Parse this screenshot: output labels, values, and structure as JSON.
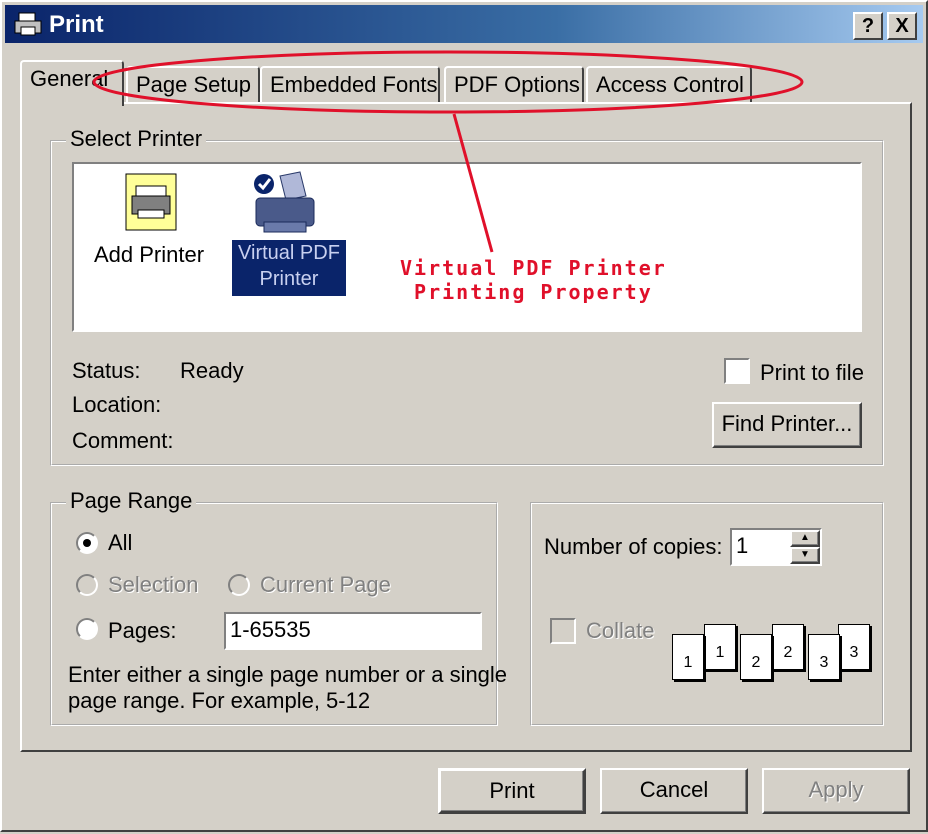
{
  "window": {
    "title": "Print",
    "help_button": "?",
    "close_button": "X"
  },
  "tabs": [
    {
      "label": "General"
    },
    {
      "label": "Page Setup"
    },
    {
      "label": "Embedded Fonts"
    },
    {
      "label": "PDF Options"
    },
    {
      "label": "Access Control"
    }
  ],
  "select_printer": {
    "legend": "Select Printer",
    "printers": [
      {
        "label": "Add Printer",
        "icon": "add-printer-icon"
      },
      {
        "label_line1": "Virtual PDF",
        "label_line2": "Printer",
        "icon": "printer-icon"
      }
    ],
    "annotation_line1": "Virtual PDF Printer",
    "annotation_line2": "Printing Property",
    "status_label": "Status:",
    "status_value": "Ready",
    "location_label": "Location:",
    "comment_label": "Comment:",
    "print_to_file_label": "Print to file",
    "find_printer_button": "Find Printer..."
  },
  "page_range": {
    "legend": "Page Range",
    "all_label": "All",
    "selection_label": "Selection",
    "current_page_label": "Current Page",
    "pages_label": "Pages:",
    "pages_value": "1-65535",
    "help_text_line1": "Enter either a single page number or a single",
    "help_text_line2": "page range.  For example, 5-12"
  },
  "copies": {
    "number_label": "Number of copies:",
    "number_value": "1",
    "collate_label": "Collate",
    "collate_pages": [
      "1",
      "1",
      "2",
      "2",
      "3",
      "3"
    ]
  },
  "buttons": {
    "print": "Print",
    "cancel": "Cancel",
    "apply": "Apply"
  },
  "colors": {
    "annotation": "#e0102a",
    "titlebar": "#0a246a",
    "selection": "#0a246a"
  }
}
